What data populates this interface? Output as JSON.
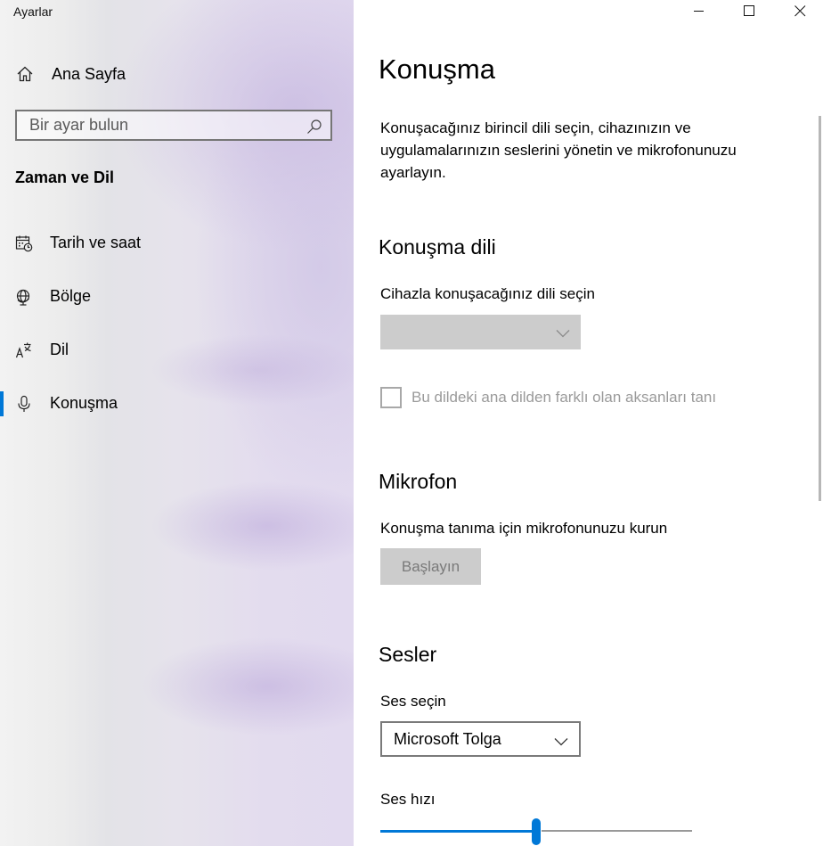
{
  "window": {
    "title": "Ayarlar",
    "controls": [
      "minimize",
      "maximize",
      "close"
    ]
  },
  "sidebar": {
    "home_label": "Ana Sayfa",
    "home_icon": "home-icon",
    "search": {
      "placeholder": "Bir ayar bulun",
      "value": ""
    },
    "section_title": "Zaman ve Dil",
    "items": [
      {
        "label": "Tarih ve saat",
        "icon": "calendar-clock-icon",
        "selected": false
      },
      {
        "label": "Bölge",
        "icon": "globe-icon",
        "selected": false
      },
      {
        "label": "Dil",
        "icon": "language-icon",
        "selected": false
      },
      {
        "label": "Konuşma",
        "icon": "microphone-icon",
        "selected": true
      }
    ],
    "accent_color": "#0078d7"
  },
  "main": {
    "title": "Konuşma",
    "description": "Konuşacağınız birincil dili seçin, cihazınızın ve uygulamalarınızın seslerini yönetin ve mikrofonunuzu ayarlayın.",
    "speech_language": {
      "heading": "Konuşma dili",
      "caption": "Cihazla konuşacağınız dili seçin",
      "dropdown_value": "",
      "dropdown_enabled": false,
      "checkbox_label": "Bu dildeki ana dilden farklı olan aksanları tanı",
      "checkbox_checked": false,
      "checkbox_enabled": false
    },
    "microphone": {
      "heading": "Mikrofon",
      "caption": "Konuşma tanıma için mikrofonunuzu kurun",
      "button_label": "Başlayın",
      "button_enabled": false
    },
    "voices": {
      "heading": "Sesler",
      "voice_caption": "Ses seçin",
      "voice_value": "Microsoft Tolga",
      "speed_caption": "Ses hızı",
      "speed_fraction": 0.5
    }
  }
}
